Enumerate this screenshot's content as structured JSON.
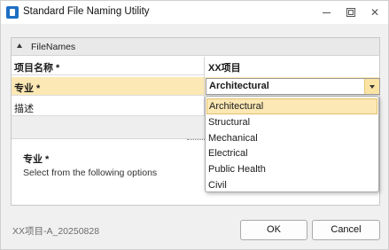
{
  "window": {
    "title": "Standard File Naming Utility",
    "icons": {
      "app": "app-icon",
      "minimize": "minimize-icon",
      "maximize": "maximize-icon",
      "close": "close-icon"
    },
    "close_glyph": "✕"
  },
  "group": {
    "label": "FileNames",
    "icon": "chevron-up-icon"
  },
  "rows": [
    {
      "label": "项目名称 *",
      "value": "XX项目"
    },
    {
      "label": "专业 *",
      "value": "Architectural"
    },
    {
      "label": "描述",
      "value": ""
    }
  ],
  "dropdown": {
    "selected": "Architectural",
    "options": [
      "Architectural",
      "Structural",
      "Mechanical",
      "Electrical",
      "Public Health",
      "Civil"
    ]
  },
  "description": {
    "title": "专业 *",
    "text": "Select from the following options"
  },
  "footer": {
    "status": "XX项目-A_20250828",
    "ok_label": "OK",
    "cancel_label": "Cancel"
  },
  "colors": {
    "highlight": "#fbe8b4",
    "accent": "#1e6fc2"
  }
}
